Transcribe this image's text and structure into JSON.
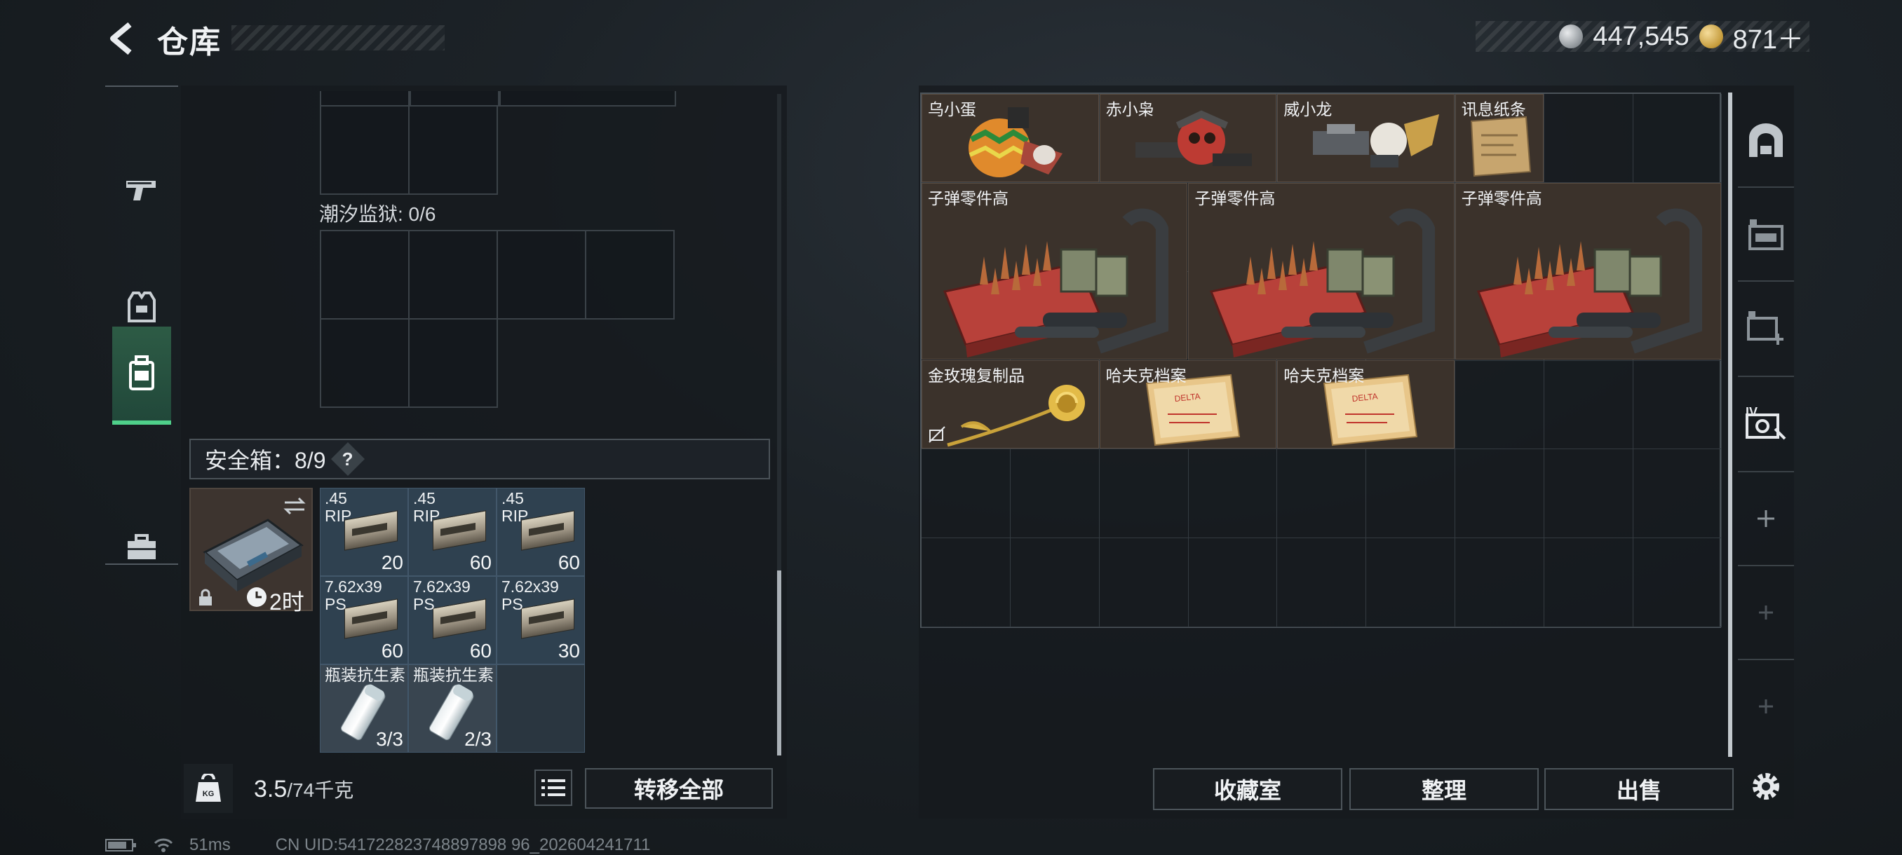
{
  "header": {
    "title": "仓库"
  },
  "currency": [
    {
      "icon": "silver-coin-icon",
      "value": "447,545"
    },
    {
      "icon": "gold-coin-icon",
      "value": "871＋"
    }
  ],
  "left_nav": [
    {
      "icon": "pistol-icon",
      "active": false
    },
    {
      "icon": "vest-icon",
      "active": false
    },
    {
      "icon": "backpack-icon",
      "active": true
    },
    {
      "icon": "briefcase-icon",
      "active": false
    }
  ],
  "left_panel": {
    "container_label": "潮汐监狱: 0/6",
    "safe_box_label": "安全箱：8/9",
    "safe_box_help": "?",
    "safe_box_timer": "2时",
    "slots": [
      {
        "name": ".45",
        "sub": "RIP",
        "count": "20",
        "type": "ammo"
      },
      {
        "name": ".45",
        "sub": "RIP",
        "count": "60",
        "type": "ammo"
      },
      {
        "name": ".45",
        "sub": "RIP",
        "count": "60",
        "type": "ammo"
      },
      {
        "name": "7.62x39",
        "sub": "PS",
        "count": "60",
        "type": "ammo"
      },
      {
        "name": "7.62x39",
        "sub": "PS",
        "count": "60",
        "type": "ammo"
      },
      {
        "name": "7.62x39",
        "sub": "PS",
        "count": "30",
        "type": "ammo"
      },
      {
        "name": "瓶装抗生素",
        "sub": "",
        "count": "3/3",
        "type": "vial"
      },
      {
        "name": "瓶装抗生素",
        "sub": "",
        "count": "2/3",
        "type": "vial"
      }
    ],
    "weight_value": "3.5",
    "weight_max": "/74千克",
    "transfer_all": "转移全部"
  },
  "stash": {
    "items": [
      {
        "name": "乌小蛋",
        "kind": "egg-figure"
      },
      {
        "name": "赤小枭",
        "kind": "owl-figure"
      },
      {
        "name": "威小龙",
        "kind": "dragon-figure"
      },
      {
        "name": "讯息纸条",
        "kind": "note"
      },
      {
        "name": "子弹零件高",
        "kind": "ammo-parts"
      },
      {
        "name": "子弹零件高",
        "kind": "ammo-parts"
      },
      {
        "name": "子弹零件高",
        "kind": "ammo-parts"
      },
      {
        "name": "金玫瑰复制品",
        "kind": "gold-rose"
      },
      {
        "name": "哈夫克档案",
        "kind": "dossier"
      },
      {
        "name": "哈夫克档案",
        "kind": "dossier"
      }
    ],
    "buttons": {
      "collection": "收藏室",
      "sort": "整理",
      "sell": "出售"
    }
  },
  "status": {
    "ping": "51ms",
    "uid": "CN UID:541722823748897898 96_202604241711"
  },
  "colors": {
    "accent_green": "#4fd08a",
    "item_bg": "#3b322b",
    "slot_blue": "#2f4150"
  }
}
